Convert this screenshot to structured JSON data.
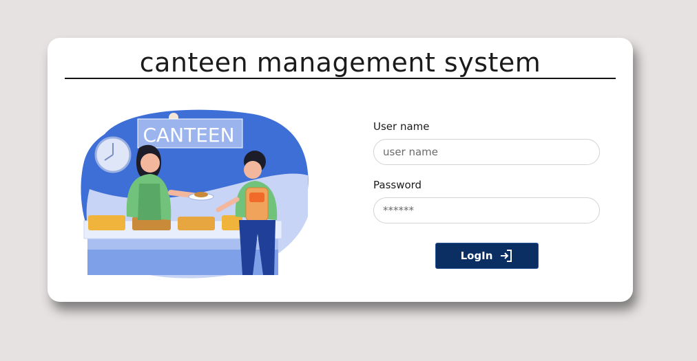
{
  "app": {
    "title": "canteen management system"
  },
  "illustration": {
    "sign_text": "CANTEEN"
  },
  "form": {
    "username_label": "User name",
    "username_placeholder": "user name",
    "password_label": "Password",
    "password_placeholder": "******",
    "login_label": "LogIn",
    "login_icon": "login-arrow-icon"
  },
  "colors": {
    "background": "#e6e2e2",
    "card": "#ffffff",
    "button": "#0b2f63",
    "illustration_blue": "#3d6fd6"
  }
}
